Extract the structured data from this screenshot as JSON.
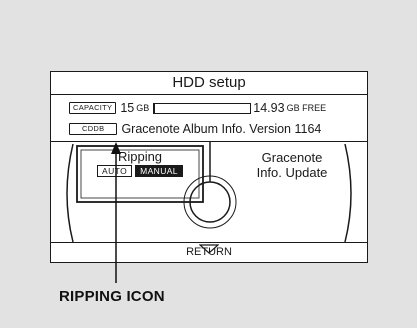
{
  "screen": {
    "title": "HDD setup",
    "capacity_tag": "CAPACITY",
    "capacity_value": "15",
    "capacity_unit": "GB",
    "capacity_used_fraction": 0.004,
    "free_value": "14.93",
    "free_unit": "GB FREE",
    "cddb_tag": "CDDB",
    "cddb_text": "Gracenote Album Info. Version 1164",
    "menu": {
      "ripping": {
        "label": "Ripping",
        "modes": [
          "AUTO",
          "MANUAL"
        ],
        "selected_mode": "MANUAL"
      },
      "gracenote_update": {
        "line1": "Gracenote",
        "line2": "Info. Update"
      }
    },
    "return_label": "RETURN"
  },
  "callout": {
    "label": "RIPPING ICON"
  },
  "colors": {
    "background": "#e2e2e2",
    "screen": "#ffffff",
    "ink": "#1a1a1a"
  }
}
